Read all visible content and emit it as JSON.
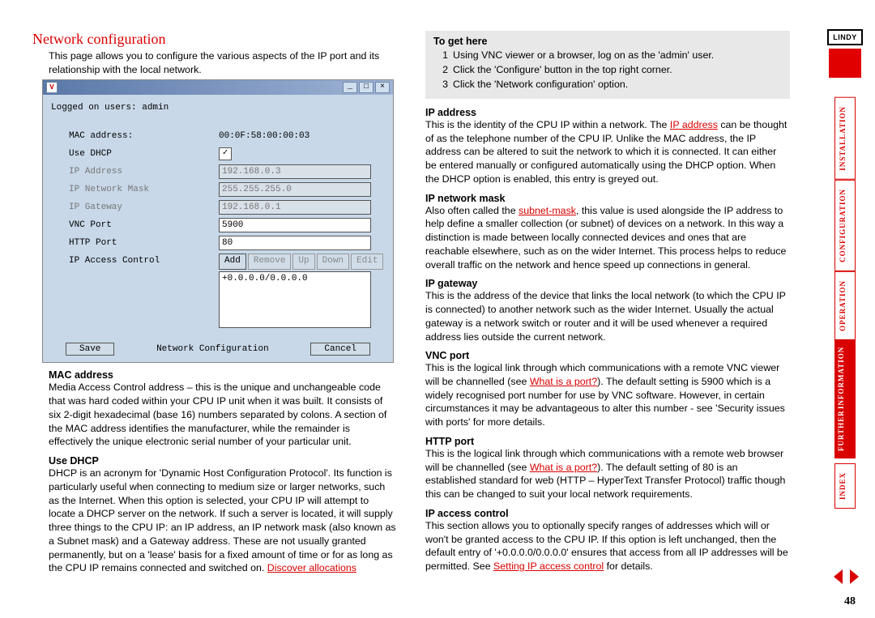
{
  "title": "Network configuration",
  "intro": "This page allows you to configure the various aspects of the IP port and its relationship with the local network.",
  "screenshot": {
    "icon_letter": "V",
    "user_line": "Logged on users: admin",
    "fields": {
      "mac_label": "MAC address:",
      "mac_value": "00:0F:58:00:00:03",
      "dhcp_label": "Use DHCP",
      "dhcp_check": "✓",
      "ipaddr_label": "IP Address",
      "ipaddr_value": "192.168.0.3",
      "mask_label": "IP Network Mask",
      "mask_value": "255.255.255.0",
      "gw_label": "IP Gateway",
      "gw_value": "192.168.0.1",
      "vnc_label": "VNC Port",
      "vnc_value": "5900",
      "http_label": "HTTP Port",
      "http_value": "80",
      "acl_label": "IP Access Control",
      "acl_entry": "+0.0.0.0/0.0.0.0"
    },
    "buttons": {
      "add": "Add",
      "remove": "Remove",
      "up": "Up",
      "down": "Down",
      "edit": "Edit",
      "save": "Save",
      "cancel": "Cancel",
      "footer_title": "Network Configuration"
    },
    "win": {
      "min": "_",
      "max": "□",
      "close": "×"
    }
  },
  "left_sections": {
    "mac_h": "MAC address",
    "mac_p": "Media Access Control address – this is the unique and unchangeable code that was hard coded within your CPU IP unit when it was built. It consists of six 2-digit hexadecimal (base 16) numbers separated by colons. A section of the MAC address identifies the manufacturer, while the remainder is effectively the unique electronic serial number of your particular unit.",
    "dhcp_h": "Use DHCP",
    "dhcp_p1": "DHCP is an acronym for 'Dynamic Host Configuration Protocol'. Its function is particularly useful when connecting to medium size or larger networks, such as the Internet. When this option is selected, your CPU IP will attempt to locate a DHCP server on the network. If such a server is located, it will supply three things to the CPU IP: an IP address, an IP network mask (also known as a Subnet mask) and a Gateway address. These are not usually granted permanently, but on a 'lease' basis for a fixed amount of time or for as long as the CPU IP remains connected and switched on. ",
    "dhcp_link": "Discover allocations"
  },
  "togethere": {
    "h": "To get here",
    "s1": "Using VNC viewer or a browser, log on as the 'admin' user.",
    "s2": "Click the 'Configure' button in the top right corner.",
    "s3": "Click the 'Network configuration' option."
  },
  "right_sections": {
    "ipaddr_h": "IP address",
    "ipaddr_p1": "This is the identity of the CPU IP within a network. The ",
    "ipaddr_link": "IP address",
    "ipaddr_p2": " can be thought of as the telephone number of the CPU IP. Unlike the MAC address, the IP address can be altered to suit the network to which it is connected. It can either be entered manually or configured automatically using the DHCP option. When the DHCP option is enabled, this entry is greyed out.",
    "mask_h": "IP network mask",
    "mask_p1": "Also often called the ",
    "mask_link": "subnet-mask",
    "mask_p2": ", this value is used alongside the IP address to help define a smaller collection (or subnet) of devices on a network. In this way a distinction is made between locally connected devices and ones that are reachable elsewhere, such as on the wider Internet. This process helps to reduce overall traffic on the network and hence speed up connections in general.",
    "gw_h": "IP gateway",
    "gw_p": "This is the address of the device that links the local network (to which the CPU IP is connected) to another network such as the wider Internet. Usually the actual gateway is a network switch or router and it will be used whenever a required address lies outside the current network.",
    "vnc_h": "VNC port",
    "vnc_p1": "This is the logical link through which communications with a remote VNC viewer will be channelled (see ",
    "vnc_link": "What is a port?",
    "vnc_p2": "). The default setting is 5900 which is a widely recognised port number for use by VNC software. However, in certain circumstances it may be advantageous to alter this number - see 'Security issues with ports' for more details.",
    "http_h": "HTTP port",
    "http_p1": "This is the logical link through which communications with a remote web browser will be channelled (see ",
    "http_link": "What is a port?",
    "http_p2": "). The default setting of 80 is an established standard for web (HTTP – HyperText Transfer Protocol) traffic though this can be changed to suit your local network requirements.",
    "acl_h": "IP access control",
    "acl_p1": "This section allows you to optionally specify ranges of addresses which will or won't be granted access to the CPU IP. If this option is left unchanged, then the default entry of '+0.0.0.0/0.0.0.0' ensures that access from all IP addresses will be permitted. See ",
    "acl_link": "Setting IP access control",
    "acl_p2": " for details."
  },
  "nav": {
    "brand": "LINDY",
    "items": [
      "INSTALLATION",
      "CONFIGURATION",
      "OPERATION"
    ],
    "further1": "FURTHER",
    "further2": "INFORMATION",
    "index": "INDEX"
  },
  "page_number": "48"
}
